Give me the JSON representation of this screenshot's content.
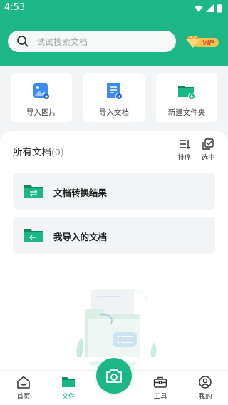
{
  "status_bar": {
    "time": "4:53",
    "icons": [
      "wifi-icon",
      "signal-icon",
      "battery-icon"
    ]
  },
  "search": {
    "placeholder": "试试搜索文档",
    "icon": "search-icon"
  },
  "vip": {
    "label": "VIP",
    "icon": "diamond-icon"
  },
  "quick_actions": [
    {
      "label": "导入图片",
      "icon": "import-image-icon"
    },
    {
      "label": "导入文档",
      "icon": "import-document-icon"
    },
    {
      "label": "新建文件夹",
      "icon": "new-folder-icon"
    }
  ],
  "docs": {
    "title": "所有文档",
    "count": "(0)",
    "sort_label": "排序",
    "select_label": "选中"
  },
  "folders": [
    {
      "label": "文档转换结果",
      "icon": "convert-folder-icon"
    },
    {
      "label": "我导入的文档",
      "icon": "import-folder-icon"
    }
  ],
  "tabbar": {
    "items": [
      {
        "label": "首页",
        "icon": "home-icon"
      },
      {
        "label": "文件",
        "icon": "folder-icon"
      },
      {
        "label": "工具",
        "icon": "toolbox-icon"
      },
      {
        "label": "我的",
        "icon": "user-icon"
      }
    ],
    "active_index": 1,
    "camera_icon": "camera-icon"
  },
  "colors": {
    "brand": "#1db787",
    "page_bg": "#f2f4f5",
    "row_bg": "#f3f4f5",
    "vip_gold": "#f3a61b"
  }
}
